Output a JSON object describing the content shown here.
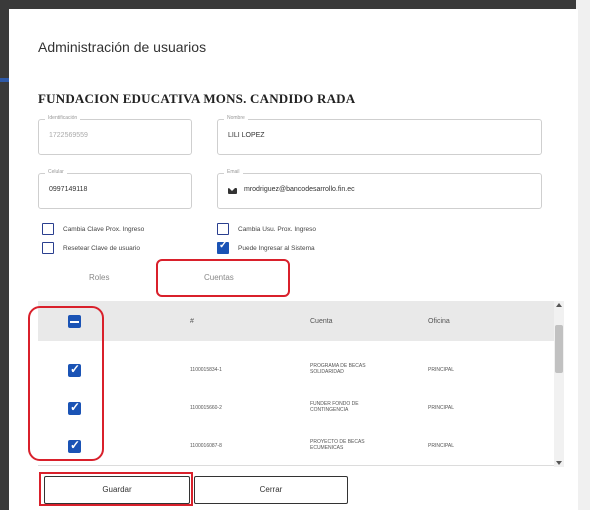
{
  "dialog": {
    "title": "Administración de usuarios",
    "org_name": "FUNDACION EDUCATIVA MONS. CANDIDO RADA"
  },
  "fields": {
    "identificacion": {
      "label": "Identificación",
      "value": "1722569559"
    },
    "nombre": {
      "label": "Nombre",
      "value": "LILI LOPEZ"
    },
    "celular": {
      "label": "Celular",
      "value": "0997149118"
    },
    "email": {
      "label": "Email",
      "value": "mrodriguez@bancodesarrollo.fin.ec",
      "icon": "mail-icon"
    }
  },
  "options": [
    {
      "label": "Cambia Clave Prox. Ingreso",
      "checked": false
    },
    {
      "label": "Resetear Clave de usuario",
      "checked": false
    },
    {
      "label": "Cambia Usu. Prox. Ingreso",
      "checked": false
    },
    {
      "label": "Puede Ingresar al Sistema",
      "checked": true
    }
  ],
  "tabs": [
    {
      "label": "Roles",
      "active": false
    },
    {
      "label": "Cuentas",
      "active": true
    }
  ],
  "table": {
    "columns": [
      "#",
      "Cuenta",
      "Oficina"
    ],
    "header_checkbox": "indeterminate",
    "rows": [
      {
        "checked": true,
        "number": "1100015834-1",
        "cuenta": "PROGRAMA DE BECAS SOLIDARIDAD",
        "oficina": "PRINCIPAL"
      },
      {
        "checked": true,
        "number": "1100015660-2",
        "cuenta": "FUNDER FONDO DE CONTINGENCIA",
        "oficina": "PRINCIPAL"
      },
      {
        "checked": true,
        "number": "1100016087-8",
        "cuenta": "PROYECTO DE BECAS ECUMENICAS",
        "oficina": "PRINCIPAL"
      }
    ]
  },
  "buttons": {
    "save": "Guardar",
    "close": "Cerrar"
  },
  "colors": {
    "accent": "#1a53b5",
    "highlight": "#d9202b"
  }
}
